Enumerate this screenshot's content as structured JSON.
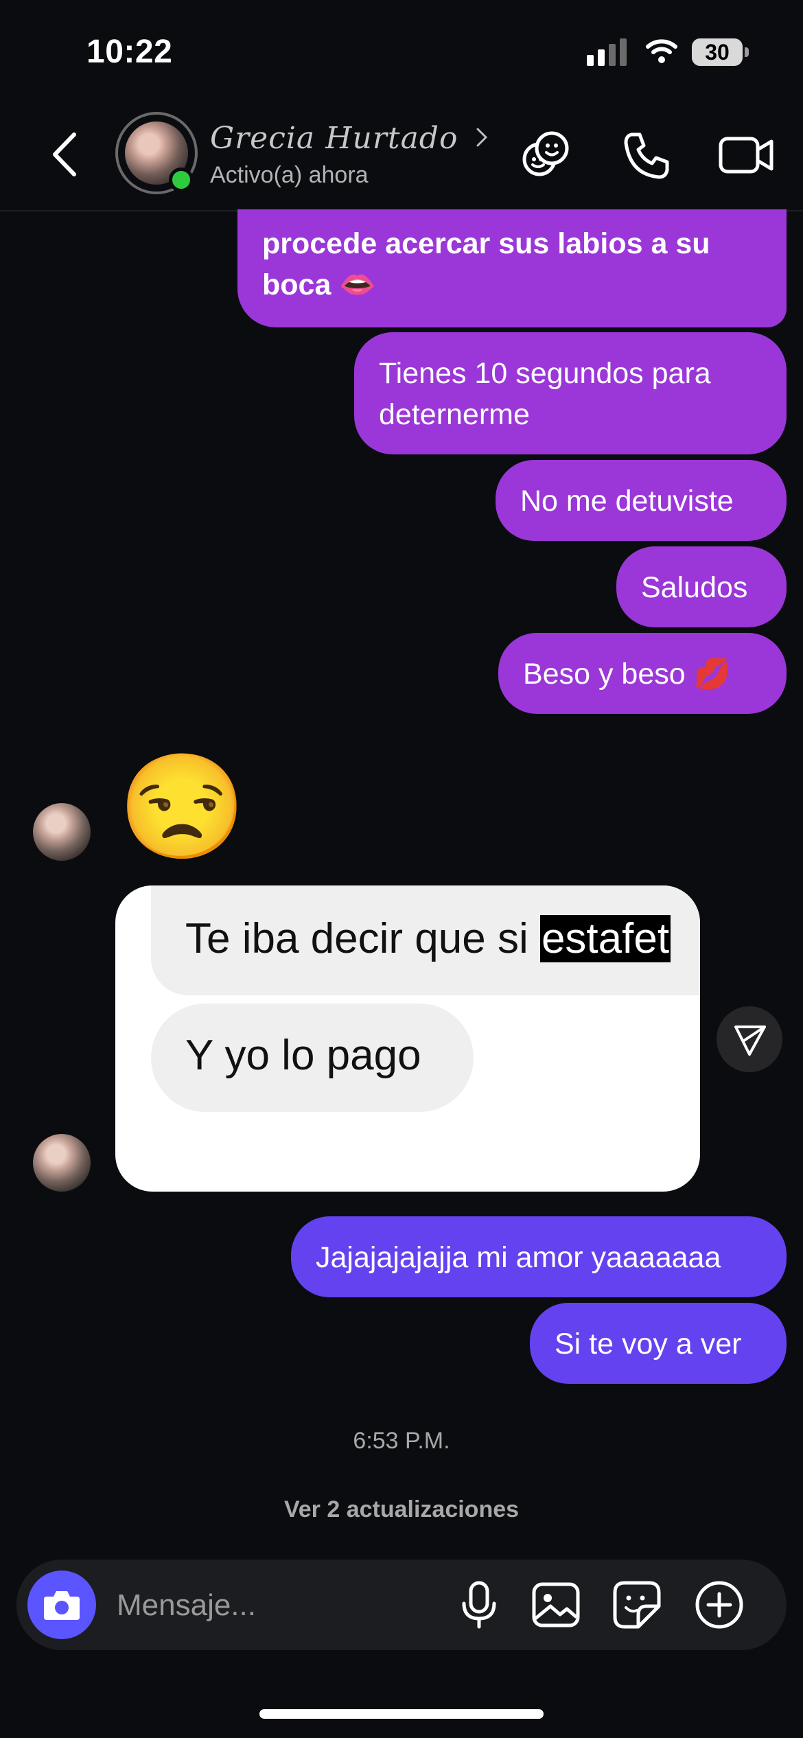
{
  "status_bar": {
    "time": "10:22",
    "battery": "30"
  },
  "header": {
    "contact_name": "Grecia Hurtado",
    "status": "Activo(a) ahora",
    "icons": [
      "back-chevron-icon",
      "sticker-faces-icon",
      "phone-icon",
      "video-camera-icon"
    ]
  },
  "messages": {
    "out_1": "procede acercar sus labios a su boca 👄",
    "out_2": "Tienes 10 segundos para deternerme",
    "out_3": "No me detuviste",
    "out_4": "Saludos",
    "out_5": "Beso y beso 💋",
    "in_emoji": "😒",
    "shared_image": {
      "line1_prefix": "Te iba decir que si ",
      "line1_highlight": "estafet",
      "line2": "Y yo lo pago"
    },
    "out_6": "Jajajajajajja mi amor yaaaaaaa",
    "out_7": "Si te voy a ver"
  },
  "timestamp": "6:53 P.M.",
  "updates_link": "Ver 2 actualizaciones",
  "composer": {
    "placeholder": "Mensaje...",
    "icons": [
      "camera-icon",
      "microphone-icon",
      "gallery-icon",
      "sticker-icon",
      "plus-icon"
    ]
  },
  "colors": {
    "background": "#0b0c10",
    "purple_bubble": "#9b37d8",
    "violet_bubble": "#6442f0",
    "camera_button": "#5a55ff",
    "online": "#2fcb3f"
  }
}
